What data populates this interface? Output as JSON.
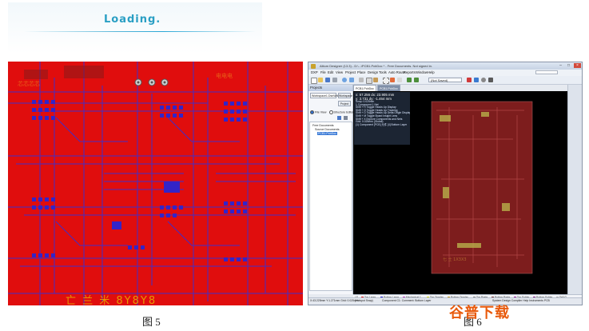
{
  "loading": {
    "text": "Loading."
  },
  "pcb_left": {
    "silkscreen": "亡 兰 米  8Y8Y8"
  },
  "window": {
    "title": "Altium Designer (13.3) - D:\\...\\PCB1.PcbDoc * - Free Documents. Not signed in.",
    "menu": [
      "DXP",
      "File",
      "Edit",
      "View",
      "Project",
      "Place",
      "Design",
      "Tools",
      "Auto Route",
      "Reports",
      "Window",
      "Help"
    ],
    "combo_value": "(Not Saved)",
    "panel_title": "Projects",
    "workspace": "Workspace1.DsnWrk",
    "workspace_btn": "Workspace",
    "project_btn": "Project",
    "radio_file": "File View",
    "radio_structure": "Structure Editor",
    "tree": [
      "Free Documents",
      "Source Documents",
      "PCB1.PcbDoc"
    ],
    "tabs": [
      "PCB1.PcbDoc",
      "PCB1.PcbDoc"
    ],
    "hud": [
      "x: 57.256   dx: 23.905 mm",
      "y: 3.731    dy: -1.464 mm",
      "Snap: 0.025mm",
      "1 Component 1 Net",
      "Shift + H  Toggle Heads Up Display",
      "Shift + G  Toggle Heads Up Tracking",
      "Shift + D  Toggle Heads Up Delta Origin Display",
      "Shift + M  Toggle Board Insight Lens",
      "Shift + X  Explore Components and Nets",
      "Grid: 0.025mm (Global)",
      "(1) Component [PCB] 元件 [4] Bottom Layer"
    ],
    "layers": [
      "LS",
      "Top Layer",
      "Bottom Layer",
      "Mechanical 1",
      "Top Overlay",
      "Bottom Overlay",
      "Top Paste",
      "Bottom Paste",
      "Top Solder",
      "Bottom Solder",
      "Drill G"
    ],
    "status": [
      "X:43.225mm Y:1.271mm   Grid: 0.025mm",
      "(Hotspot Snap)",
      "Component C1: Comment: Bottom Layer",
      "System   Design Compiler   Help   Instruments   PCB"
    ]
  },
  "captions": {
    "left": "图 5",
    "right": "图 6"
  },
  "watermark": {
    "text": "谷普下载",
    "sub": "WWW.GUPU.NET"
  },
  "colors": {
    "board_red": "#e00d0d",
    "trace_blue": "#3a2fd0",
    "dark_red": "#7d1d1d"
  }
}
